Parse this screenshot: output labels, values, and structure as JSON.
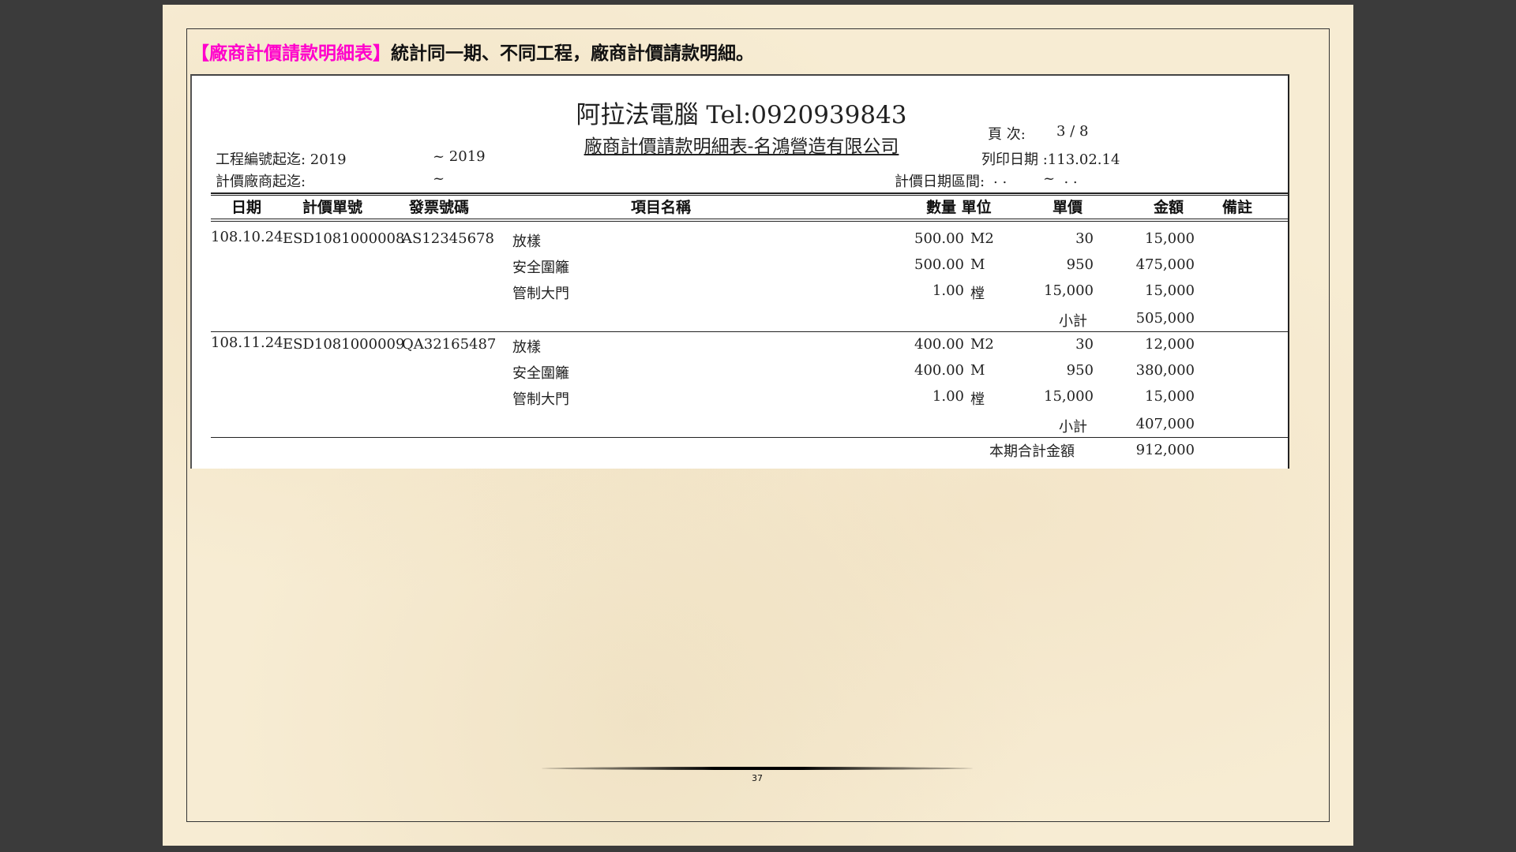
{
  "heading": {
    "tag": "【廠商計價請款明細表】",
    "text": "統計同一期、不同工程，廠商計價請款明細。"
  },
  "report": {
    "company": "阿拉法電腦 Tel:0920939843",
    "subtitle": "廠商計價請款明細表-名鴻營造有限公司",
    "project_range_label": "工程編號起迄: 2019",
    "project_range_to": "~ 2019",
    "vendor_range_label": "計價廠商起迄:",
    "vendor_range_to": "~",
    "page_label": "頁 次:",
    "page_value": "3 / 8",
    "print_date": "列印日期 :113.02.14",
    "date_range_label": "計價日期區間:",
    "date_range_value": ". .        ~  . .",
    "columns": [
      "日期",
      "計價單號",
      "發票號碼",
      "項目名稱",
      "數量 單位",
      "單價",
      "金額",
      "備註"
    ],
    "groups": [
      {
        "date": "108.10.24",
        "doc_no": "ESD1081000008",
        "invoice": "AS12345678",
        "items": [
          {
            "name": "放樣",
            "qty": "500.00",
            "unit": "M2",
            "price": "30",
            "amount": "15,000"
          },
          {
            "name": "安全圍籬",
            "qty": "500.00",
            "unit": "M",
            "price": "950",
            "amount": "475,000"
          },
          {
            "name": "管制大門",
            "qty": "1.00",
            "unit": "樘",
            "price": "15,000",
            "amount": "15,000"
          }
        ],
        "subtotal_label": "小計",
        "subtotal": "505,000"
      },
      {
        "date": "108.11.24",
        "doc_no": "ESD1081000009",
        "invoice": "QA32165487",
        "items": [
          {
            "name": "放樣",
            "qty": "400.00",
            "unit": "M2",
            "price": "30",
            "amount": "12,000"
          },
          {
            "name": "安全圍籬",
            "qty": "400.00",
            "unit": "M",
            "price": "950",
            "amount": "380,000"
          },
          {
            "name": "管制大門",
            "qty": "1.00",
            "unit": "樘",
            "price": "15,000",
            "amount": "15,000"
          }
        ],
        "subtotal_label": "小計",
        "subtotal": "407,000"
      }
    ],
    "total_label": "本期合計金額",
    "total": "912,000"
  },
  "page_number": "37"
}
